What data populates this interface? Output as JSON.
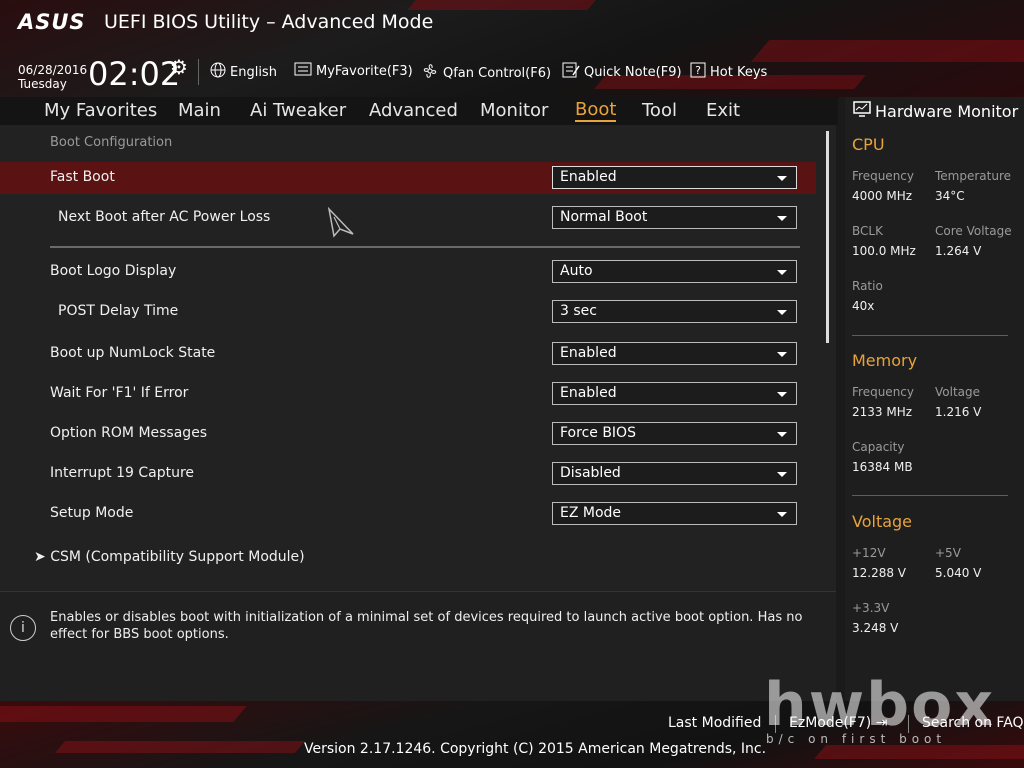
{
  "header": {
    "brand": "ASUS",
    "title": "UEFI BIOS Utility – Advanced Mode",
    "date": "06/28/2016",
    "day": "Tuesday",
    "time": "02:02",
    "toolbar": {
      "language": "English",
      "favorite": "MyFavorite(F3)",
      "qfan": "Qfan Control(F6)",
      "quicknote": "Quick Note(F9)",
      "hotkeys": "Hot Keys"
    }
  },
  "tabs": [
    "My Favorites",
    "Main",
    "Ai Tweaker",
    "Advanced",
    "Monitor",
    "Boot",
    "Tool",
    "Exit"
  ],
  "active_tab": "Boot",
  "section_title": "Boot Configuration",
  "settings": [
    {
      "label": "Fast Boot",
      "value": "Enabled"
    },
    {
      "label": "Next Boot after AC Power Loss",
      "value": "Normal Boot"
    },
    {
      "label": "Boot Logo Display",
      "value": "Auto"
    },
    {
      "label": "POST Delay Time",
      "value": "3 sec"
    },
    {
      "label": "Boot up NumLock State",
      "value": "Enabled"
    },
    {
      "label": "Wait For 'F1' If Error",
      "value": "Enabled"
    },
    {
      "label": "Option ROM Messages",
      "value": "Force BIOS"
    },
    {
      "label": "Interrupt 19 Capture",
      "value": "Disabled"
    },
    {
      "label": "Setup Mode",
      "value": "EZ Mode"
    }
  ],
  "submenu": "CSM (Compatibility Support Module)",
  "help_text": "Enables or disables boot with initialization of a minimal set of devices required to launch active boot option. Has no effect for BBS boot options.",
  "hardware_monitor": {
    "title": "Hardware Monitor",
    "cpu": {
      "heading": "CPU",
      "frequency_label": "Frequency",
      "frequency": "4000 MHz",
      "temperature_label": "Temperature",
      "temperature": "34°C",
      "bclk_label": "BCLK",
      "bclk": "100.0 MHz",
      "core_voltage_label": "Core Voltage",
      "core_voltage": "1.264 V",
      "ratio_label": "Ratio",
      "ratio": "40x"
    },
    "memory": {
      "heading": "Memory",
      "frequency_label": "Frequency",
      "frequency": "2133 MHz",
      "voltage_label": "Voltage",
      "voltage": "1.216 V",
      "capacity_label": "Capacity",
      "capacity": "16384 MB"
    },
    "voltage": {
      "heading": "Voltage",
      "v12_label": "+12V",
      "v12": "12.288 V",
      "v5_label": "+5V",
      "v5": "5.040 V",
      "v33_label": "+3.3V",
      "v33": "3.248 V"
    }
  },
  "footer": {
    "last_modified": "Last Modified",
    "ez_mode": "EzMode(F7)",
    "search_faq": "Search on FAQ",
    "version": "Version 2.17.1246. Copyright (C) 2015 American Megatrends, Inc."
  },
  "watermark": {
    "logo": "hwbox",
    "tagline": "b/c on first boot"
  },
  "colors": {
    "accent": "#e8a33a",
    "highlight_row": "#5a1212",
    "background": "#222222"
  }
}
